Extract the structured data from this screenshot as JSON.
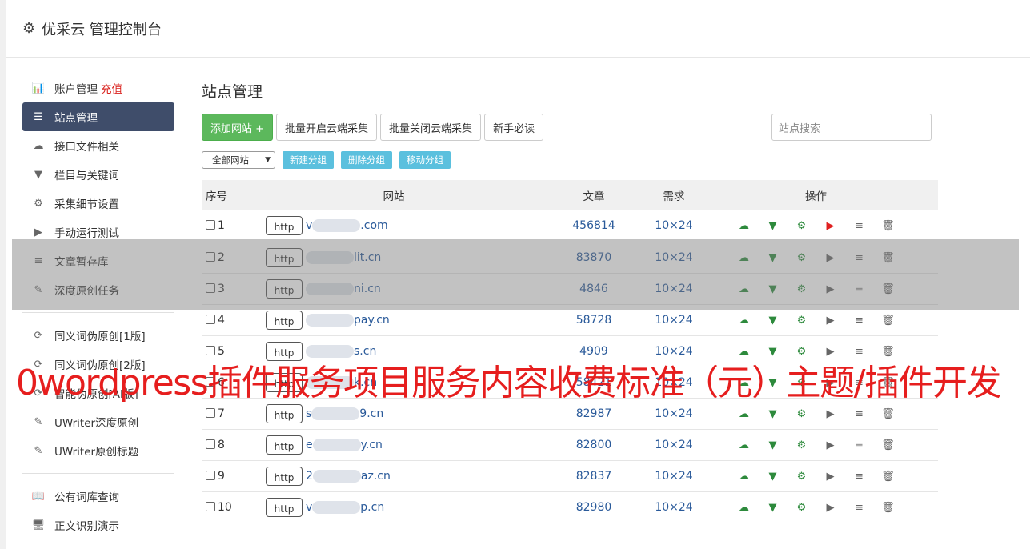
{
  "header": {
    "title": "优采云 管理控制台"
  },
  "sidebar": {
    "items": [
      {
        "label": "账户管理",
        "extra": "充值",
        "icon": "bar-chart-icon",
        "glyph": "📊"
      },
      {
        "label": "站点管理",
        "icon": "server-icon",
        "glyph": "☰",
        "active": true
      },
      {
        "label": "接口文件相关",
        "icon": "cloud-upload-icon",
        "glyph": "☁"
      },
      {
        "label": "栏目与关键词",
        "icon": "filter-icon",
        "glyph": "▼"
      },
      {
        "label": "采集细节设置",
        "icon": "cogs-icon",
        "glyph": "⚙"
      },
      {
        "label": "手动运行测试",
        "icon": "play-circle-icon",
        "glyph": "▶"
      },
      {
        "label": "文章暂存库",
        "icon": "database-icon",
        "glyph": "≡"
      },
      {
        "label": "深度原创任务",
        "icon": "edit-icon",
        "glyph": "✎"
      }
    ],
    "items2": [
      {
        "label": "同义词伪原创[1版]",
        "icon": "refresh-icon",
        "glyph": "⟳"
      },
      {
        "label": "同义词伪原创[2版]",
        "icon": "refresh-icon",
        "glyph": "⟳"
      },
      {
        "label": "智能伪原创[AI版]",
        "icon": "refresh-icon",
        "glyph": "⟳"
      },
      {
        "label": "UWriter深度原创",
        "icon": "edit-icon",
        "glyph": "✎"
      },
      {
        "label": "UWriter原创标题",
        "icon": "edit-icon",
        "glyph": "✎"
      }
    ],
    "items3": [
      {
        "label": "公有词库查询",
        "icon": "book-icon",
        "glyph": "📖"
      },
      {
        "label": "正文识别演示",
        "icon": "desktop-icon",
        "glyph": "🖥"
      }
    ]
  },
  "main": {
    "title": "站点管理",
    "toolbar": {
      "add_site": "添加网站 +",
      "batch_open": "批量开启云端采集",
      "batch_close": "批量关闭云端采集",
      "newbie": "新手必读"
    },
    "search_placeholder": "站点搜索",
    "group_select": "全部网站",
    "group_buttons": {
      "new": "新建分组",
      "delete": "删除分组",
      "move": "移动分组"
    },
    "table": {
      "headers": [
        "序号",
        "网站",
        "文章",
        "需求",
        "操作"
      ],
      "http_label": "http",
      "rows": [
        {
          "no": "1",
          "prefix": "v",
          "suffix": ".com",
          "articles": "456814",
          "demand": "10×24",
          "running": true
        },
        {
          "no": "2",
          "prefix": "",
          "suffix": "lit.cn",
          "articles": "83870",
          "demand": "10×24",
          "running": false
        },
        {
          "no": "3",
          "prefix": "",
          "suffix": "ni.cn",
          "articles": "4846",
          "demand": "10×24",
          "running": false
        },
        {
          "no": "4",
          "prefix": "",
          "suffix": "pay.cn",
          "articles": "58728",
          "demand": "10×24",
          "running": false
        },
        {
          "no": "5",
          "prefix": "",
          "suffix": "s.cn",
          "articles": "4909",
          "demand": "10×24",
          "running": false
        },
        {
          "no": "6",
          "prefix": "",
          "suffix": "k.cn",
          "articles": "58421",
          "demand": "10×24",
          "running": false
        },
        {
          "no": "7",
          "prefix": "s",
          "suffix": "9.cn",
          "articles": "82987",
          "demand": "10×24",
          "running": false
        },
        {
          "no": "8",
          "prefix": "e",
          "suffix": "y.cn",
          "articles": "82800",
          "demand": "10×24",
          "running": false
        },
        {
          "no": "9",
          "prefix": "2",
          "suffix": "az.cn",
          "articles": "82837",
          "demand": "10×24",
          "running": false
        },
        {
          "no": "10",
          "prefix": "v",
          "suffix": "p.cn",
          "articles": "82980",
          "demand": "10×24",
          "running": false
        }
      ]
    }
  },
  "banner": "0wordpress插件服务项目服务内容收费标准（元）主题/插件开发",
  "colors": {
    "accent_green": "#5cb85c",
    "info_blue": "#5bc0de",
    "sidebar_active": "#3f4d6a",
    "banner_red": "#e61e1e"
  }
}
